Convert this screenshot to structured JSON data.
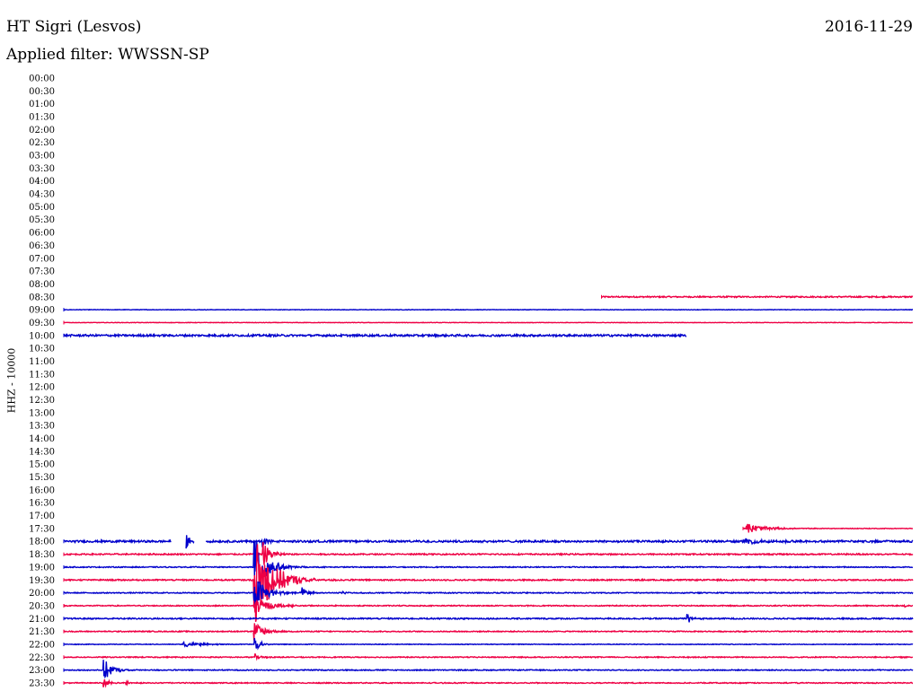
{
  "header": {
    "station": "HT Sigri (Lesvos)",
    "date": "2016-11-29",
    "filter": "Applied filter: WWSSN-SP"
  },
  "chart_data": {
    "type": "line",
    "title": "HT Sigri (Lesvos)",
    "ylabel": "HHZ - 10000",
    "y_ticks": [
      "00:00",
      "00:30",
      "01:00",
      "01:30",
      "02:00",
      "02:30",
      "03:00",
      "03:30",
      "04:00",
      "04:30",
      "05:00",
      "05:30",
      "06:00",
      "06:30",
      "07:00",
      "07:30",
      "08:00",
      "08:30",
      "09:00",
      "09:30",
      "10:00",
      "10:30",
      "11:00",
      "11:30",
      "12:00",
      "12:30",
      "13:00",
      "13:30",
      "14:00",
      "14:30",
      "15:00",
      "15:30",
      "16:00",
      "16:30",
      "17:00",
      "17:30",
      "18:00",
      "18:30",
      "19:00",
      "19:30",
      "20:00",
      "20:30",
      "21:00",
      "21:30",
      "22:00",
      "22:30",
      "23:00",
      "23:30"
    ],
    "x_unit": "minutes within line (0-30)",
    "colors": {
      "even_line": "#0000cc",
      "odd_line": "#ee0044"
    },
    "grid": false,
    "traces": [
      {
        "line": "08:30",
        "start_min": 19.0,
        "end_min": 30.0,
        "noise": 0.08
      },
      {
        "line": "09:00",
        "start_min": 0,
        "end_min": 30.0,
        "noise": 0.03
      },
      {
        "line": "09:30",
        "start_min": 0,
        "end_min": 30.0,
        "noise": 0.03
      },
      {
        "line": "10:00",
        "start_min": 0,
        "end_min": 22.0,
        "noise": 0.12
      },
      {
        "line": "17:30",
        "start_min": 24.0,
        "end_min": 30.0,
        "noise": 0.04,
        "events": [
          {
            "t_min": 24.1,
            "amp": 0.7,
            "decay_min": 0.6
          }
        ]
      },
      {
        "line": "18:00",
        "start_min": 0,
        "end_min": 30.0,
        "noise": 0.12,
        "gaps": [
          [
            3.8,
            4.3
          ],
          [
            4.6,
            5.0
          ]
        ],
        "events": [
          {
            "t_min": 4.3,
            "amp": 1.6,
            "decay_min": 0.1
          },
          {
            "t_min": 7.0,
            "amp": 0.8,
            "decay_min": 0.15
          },
          {
            "t_min": 24.0,
            "amp": 0.3,
            "decay_min": 1.0
          }
        ]
      },
      {
        "line": "18:30",
        "start_min": 0,
        "end_min": 30.0,
        "noise": 0.08,
        "events": [
          {
            "t_min": 7.0,
            "amp": 2.0,
            "decay_min": 0.25
          }
        ]
      },
      {
        "line": "19:00",
        "start_min": 0,
        "end_min": 30.0,
        "noise": 0.06,
        "events": [
          {
            "t_min": 6.7,
            "amp": 4.5,
            "decay_min": 0.4
          }
        ]
      },
      {
        "line": "19:30",
        "start_min": 0,
        "end_min": 30.0,
        "noise": 0.08,
        "events": [
          {
            "t_min": 6.7,
            "amp": 6.0,
            "decay_min": 0.6
          }
        ]
      },
      {
        "line": "20:00",
        "start_min": 0,
        "end_min": 30.0,
        "noise": 0.06,
        "events": [
          {
            "t_min": 6.7,
            "amp": 2.5,
            "decay_min": 0.4
          },
          {
            "t_min": 8.4,
            "amp": 0.8,
            "decay_min": 0.2
          },
          {
            "t_min": 9.8,
            "amp": 0.5,
            "decay_min": 0.1
          }
        ]
      },
      {
        "line": "20:30",
        "start_min": 0,
        "end_min": 30.0,
        "noise": 0.06,
        "events": [
          {
            "t_min": 6.7,
            "amp": 1.2,
            "decay_min": 0.5
          },
          {
            "t_min": 29.7,
            "amp": 0.4,
            "decay_min": 0.05
          }
        ]
      },
      {
        "line": "21:00",
        "start_min": 0,
        "end_min": 30.0,
        "noise": 0.08,
        "events": [
          {
            "t_min": 22.0,
            "amp": 0.8,
            "decay_min": 0.15
          }
        ]
      },
      {
        "line": "21:30",
        "start_min": 0,
        "end_min": 30.0,
        "noise": 0.06,
        "events": [
          {
            "t_min": 6.7,
            "amp": 1.5,
            "decay_min": 0.3
          }
        ]
      },
      {
        "line": "22:00",
        "start_min": 0,
        "end_min": 30.0,
        "noise": 0.04,
        "events": [
          {
            "t_min": 4.2,
            "amp": 0.35,
            "decay_min": 0.6
          },
          {
            "t_min": 6.7,
            "amp": 1.0,
            "decay_min": 0.2
          }
        ]
      },
      {
        "line": "22:30",
        "start_min": 0,
        "end_min": 30.0,
        "noise": 0.06,
        "events": [
          {
            "t_min": 6.7,
            "amp": 0.6,
            "decay_min": 0.2
          }
        ]
      },
      {
        "line": "23:00",
        "start_min": 0,
        "end_min": 30.0,
        "noise": 0.06,
        "events": [
          {
            "t_min": 1.4,
            "amp": 1.4,
            "decay_min": 0.3
          }
        ]
      },
      {
        "line": "23:30",
        "start_min": 0,
        "end_min": 30.0,
        "noise": 0.06,
        "events": [
          {
            "t_min": 1.4,
            "amp": 0.6,
            "decay_min": 0.2
          },
          {
            "t_min": 2.2,
            "amp": 0.3,
            "decay_min": 0.1
          }
        ]
      }
    ]
  }
}
